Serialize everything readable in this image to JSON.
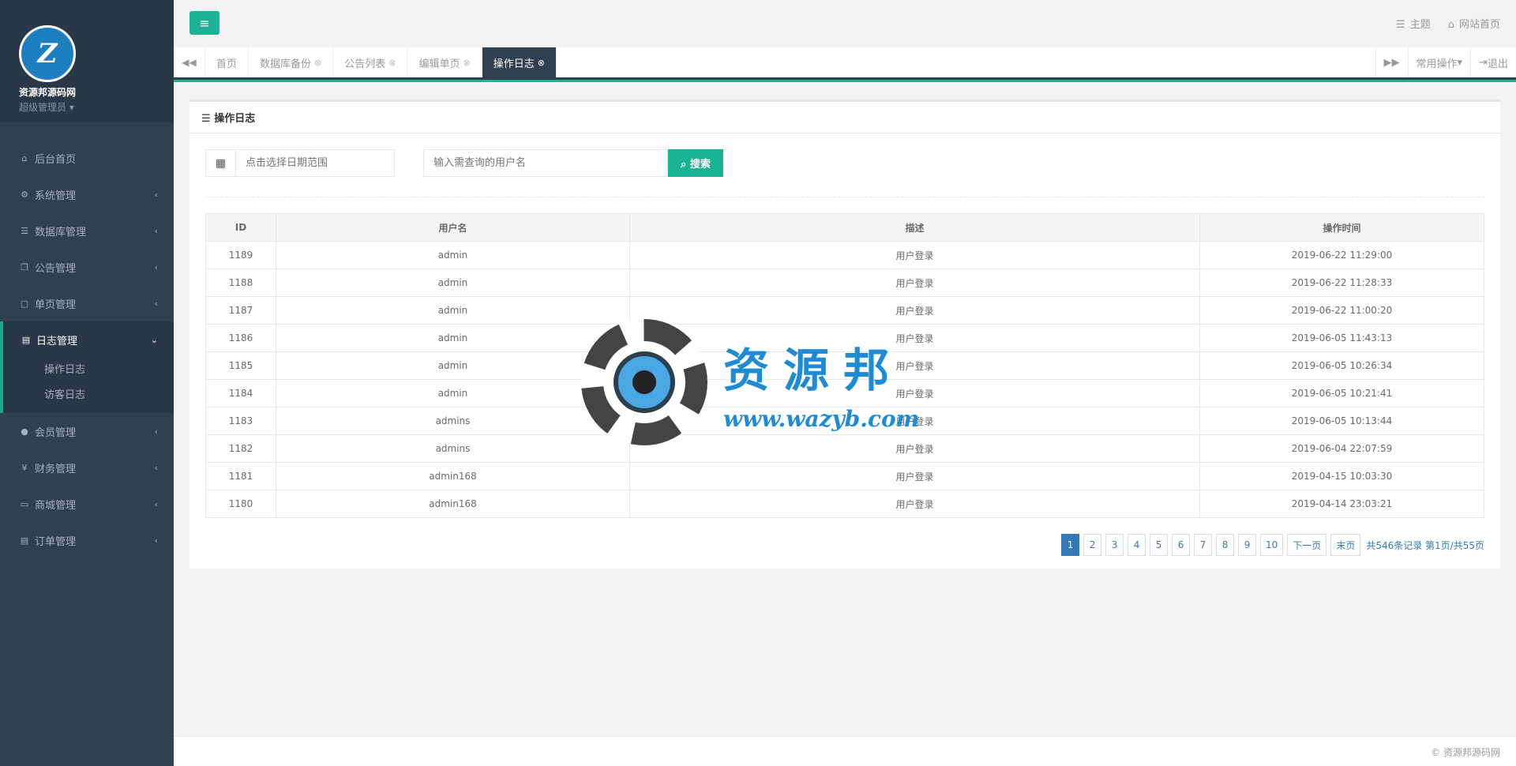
{
  "sidebar": {
    "logo_text": "Z",
    "site_name": "资源邦源码网",
    "role": "超级管理员",
    "items": [
      {
        "label": "后台首页",
        "icon": "home-icon",
        "glyph": "⌂"
      },
      {
        "label": "系统管理",
        "icon": "gear-icon",
        "glyph": "⚙"
      },
      {
        "label": "数据库管理",
        "icon": "database-icon",
        "glyph": "☰"
      },
      {
        "label": "公告管理",
        "icon": "copy-icon",
        "glyph": "❐"
      },
      {
        "label": "单页管理",
        "icon": "file-icon",
        "glyph": "▢"
      },
      {
        "label": "日志管理",
        "icon": "file-text-icon",
        "glyph": "▤"
      },
      {
        "label": "会员管理",
        "icon": "user-icon",
        "glyph": "●"
      },
      {
        "label": "财务管理",
        "icon": "yen-icon",
        "glyph": "¥"
      },
      {
        "label": "商城管理",
        "icon": "desktop-icon",
        "glyph": "▭"
      },
      {
        "label": "订单管理",
        "icon": "file-text-icon",
        "glyph": "▤"
      }
    ],
    "sub_items": [
      "操作日志",
      "访客日志"
    ]
  },
  "topbar": {
    "theme": "主题",
    "site_home": "网站首页"
  },
  "tabs": {
    "items": [
      "首页",
      "数据库备份",
      "公告列表",
      "编辑单页",
      "操作日志"
    ],
    "common_ops": "常用操作",
    "logout": "退出"
  },
  "panel": {
    "title": "操作日志",
    "date_placeholder": "点击选择日期范围",
    "user_placeholder": "输入需查询的用户名",
    "search_label": "搜索"
  },
  "table": {
    "headers": [
      "ID",
      "用户名",
      "描述",
      "操作时间"
    ],
    "rows": [
      [
        "1189",
        "admin",
        "用户登录",
        "2019-06-22 11:29:00"
      ],
      [
        "1188",
        "admin",
        "用户登录",
        "2019-06-22 11:28:33"
      ],
      [
        "1187",
        "admin",
        "用户登录",
        "2019-06-22 11:00:20"
      ],
      [
        "1186",
        "admin",
        "用户登录",
        "2019-06-05 11:43:13"
      ],
      [
        "1185",
        "admin",
        "用户登录",
        "2019-06-05 10:26:34"
      ],
      [
        "1184",
        "admin",
        "用户登录",
        "2019-06-05 10:21:41"
      ],
      [
        "1183",
        "admins",
        "用户登录",
        "2019-06-05 10:13:44"
      ],
      [
        "1182",
        "admins",
        "用户登录",
        "2019-06-04 22:07:59"
      ],
      [
        "1181",
        "admin168",
        "用户登录",
        "2019-04-15 10:03:30"
      ],
      [
        "1180",
        "admin168",
        "用户登录",
        "2019-04-14 23:03:21"
      ]
    ]
  },
  "pager": {
    "pages": [
      "1",
      "2",
      "3",
      "4",
      "5",
      "6",
      "7",
      "8",
      "9",
      "10"
    ],
    "next": "下一页",
    "last": "末页",
    "info": "共546条记录 第1页/共55页"
  },
  "footer": "© 资源邦源码网",
  "watermark": {
    "cn": "资源邦",
    "url": "www.wazyb.com"
  },
  "colors": {
    "accent": "#1ab394",
    "sidebar": "#2f4050",
    "link": "#337ab7"
  }
}
